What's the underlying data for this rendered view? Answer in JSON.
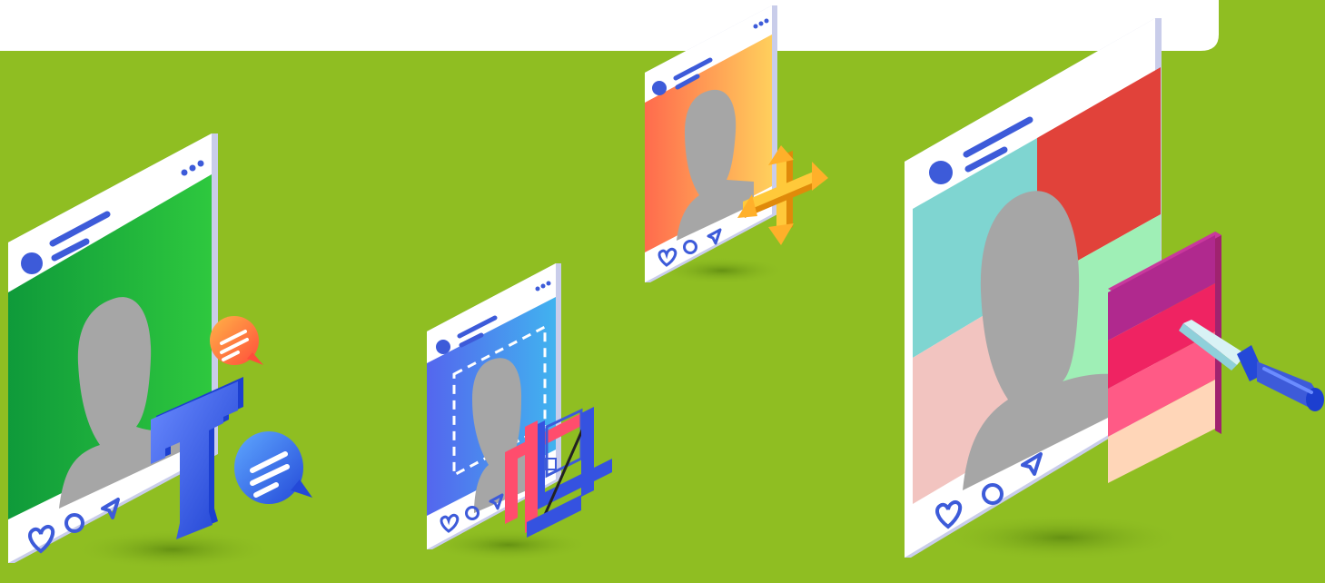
{
  "scene": {
    "description_tags": [
      "photo-editor-illustration"
    ],
    "colors": {
      "background": "#8fbe22",
      "top_banner": "#ffffff",
      "frame_face": "#ffffff",
      "frame_edge": "#c9cdea",
      "ui_blue": "#3d5bd9",
      "silhouette": "#a6a6a6"
    }
  },
  "cards": [
    {
      "name": "text-editing-post",
      "photo_gradient": [
        "#0f9a3a",
        "#2ec83e"
      ],
      "tool": "text-tool",
      "accessory_icons": [
        "text-t-icon",
        "chat-bubble-icon",
        "chat-bubble-icon"
      ]
    },
    {
      "name": "crop-post",
      "photo_gradient": [
        "#5466ee",
        "#41b3ef"
      ],
      "tool": "crop-tool",
      "accessory_icons": [
        "crop-icon",
        "selection-marquee-icon"
      ]
    },
    {
      "name": "move-post",
      "photo_gradient": [
        "#ff6b4d",
        "#ffcf5c"
      ],
      "tool": "move-tool",
      "accessory_icons": [
        "move-arrows-icon"
      ]
    },
    {
      "name": "color-picker-post",
      "photo_quadrants": [
        "#7fd5d1",
        "#e1423a",
        "#f2c4c0",
        "#9fefb6"
      ],
      "tool": "eyedropper-tool",
      "swatches": [
        "#b0298e",
        "#ef2362",
        "#ff5a86",
        "#ffd6b8"
      ],
      "accessory_icons": [
        "eyedropper-icon",
        "color-swatch-icon"
      ]
    }
  ],
  "post_actions": [
    "heart-icon",
    "comment-icon",
    "share-icon"
  ]
}
